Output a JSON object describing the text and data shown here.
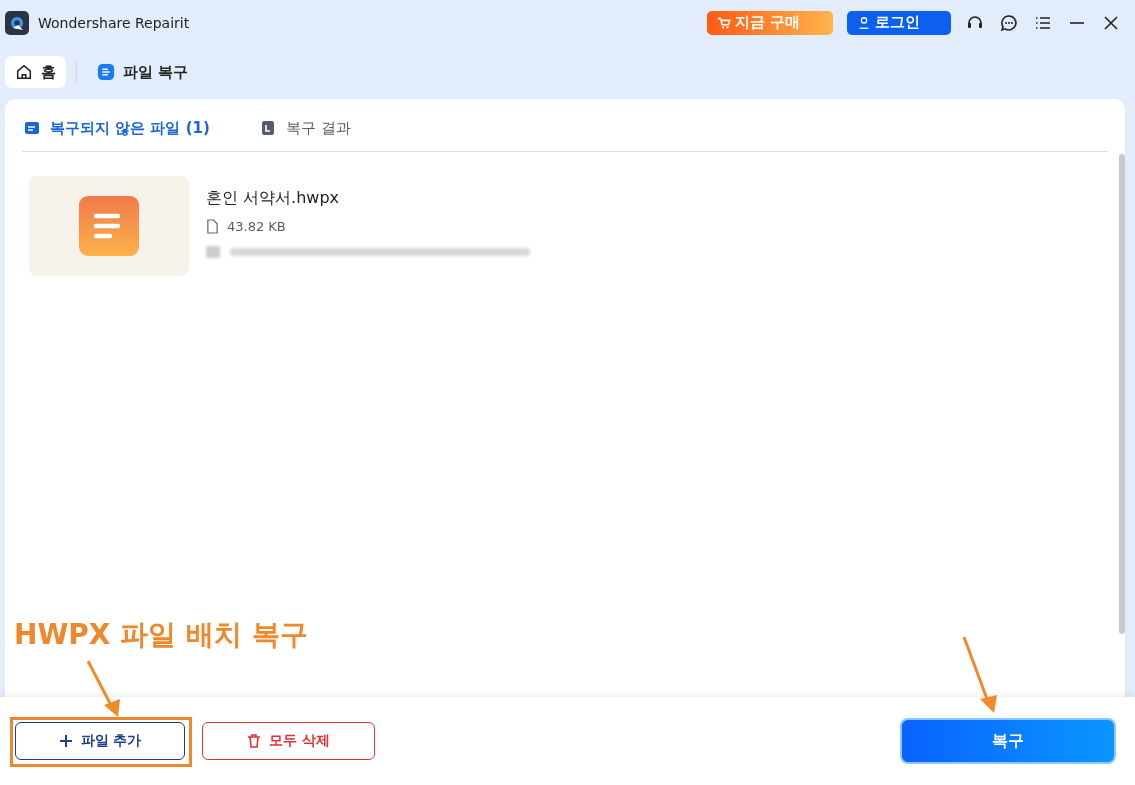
{
  "window": {
    "title": "Wondershare Repairit",
    "buy_button": "지금 구매",
    "login_button": "로그인"
  },
  "nav": [
    {
      "label": "홈",
      "kind": "home",
      "selected": true
    },
    {
      "label": "파일 복구",
      "kind": "page",
      "selected": false
    }
  ],
  "tabs": [
    {
      "label": "복구되지 않은 파일 (1)",
      "selected": true
    },
    {
      "label": "복구 결과",
      "selected": false
    }
  ],
  "files": [
    {
      "name": "혼인 서약서.hwpx",
      "size": "43.82 KB"
    }
  ],
  "annotation": {
    "text": "HWPX 파일 배치 복구"
  },
  "buttons": {
    "add": "파일 추가",
    "delete_all": "모두 삭제",
    "repair": "복구"
  }
}
